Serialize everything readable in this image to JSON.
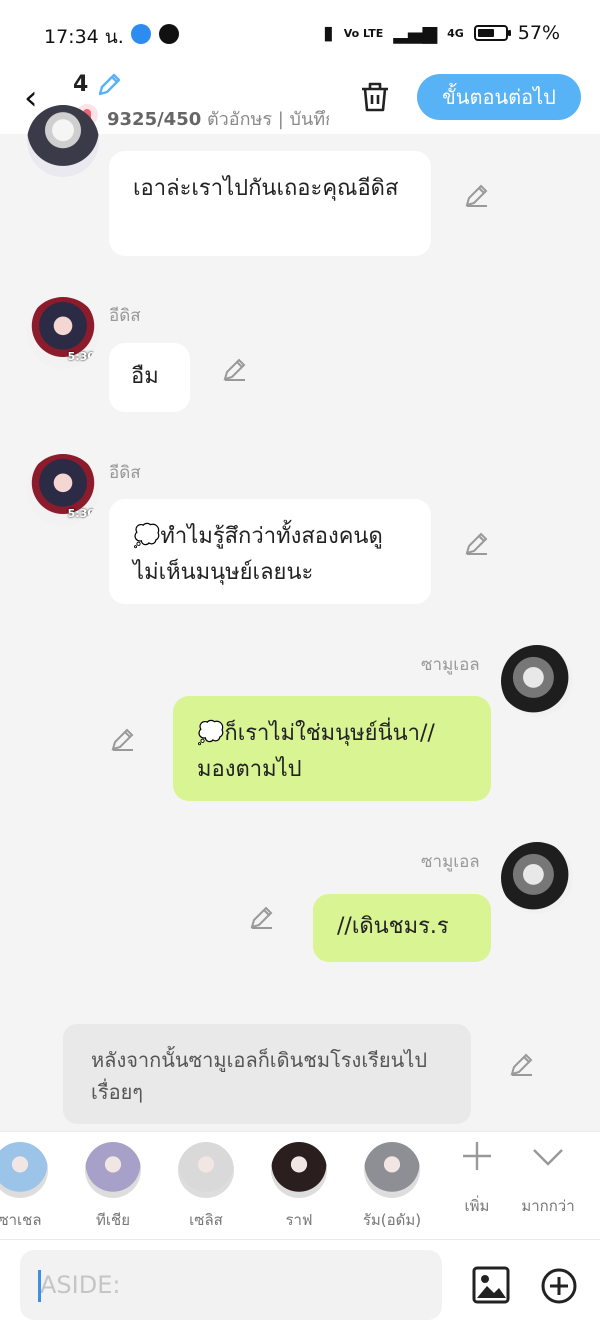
{
  "status": {
    "time": "17:34 น.",
    "battery": "57%",
    "volte": "Vo LTE",
    "network": "4G"
  },
  "header": {
    "count": "4",
    "chars": "9325/450",
    "chars_label": "ตัวอักษร | บันทึก",
    "next_label": "ขั้นตอนต่อไป"
  },
  "messages": [
    {
      "text": "เอาล่ะเราไปกันเถอะคุณอีดิส"
    },
    {
      "sender": "อีดิส",
      "time": "5:30",
      "text": "อืม"
    },
    {
      "sender": "อีดิส",
      "time": "5:30",
      "text": "💭ทำไมรู้สึกว่าทั้งสองคนดูไม่เห็นมนุษย์เลยนะ"
    },
    {
      "sender": "ซามูเอล",
      "text": "💭ก็เราไม่ใช่มนุษย์นี่นา//มองตามไป"
    },
    {
      "sender": "ซามูเอล",
      "text": "//เดินชมร.ร"
    }
  ],
  "narration": {
    "text": "หลังจากนั้นซามูเอลก็เดินชมโรงเรียนไปเรื่อยๆ"
  },
  "characters": [
    {
      "name": "ซาเชล",
      "color": "#9cc3e8"
    },
    {
      "name": "ทีเชีย",
      "color": "#a7a1c9"
    },
    {
      "name": "เซลิส",
      "color": "#d9d9d9"
    },
    {
      "name": "ราฟ",
      "color": "#2a1e1e"
    },
    {
      "name": "รัม(อดัม)",
      "color": "#8d8f95"
    }
  ],
  "strip_buttons": {
    "add_label": "เพิ่ม",
    "more_label": "มากกว่า"
  },
  "input": {
    "placeholder": "ASIDE:"
  },
  "colors": {
    "accent": "#58b2f6",
    "user_bubble": "#d8f493",
    "bot_bubble": "#ffffff"
  }
}
